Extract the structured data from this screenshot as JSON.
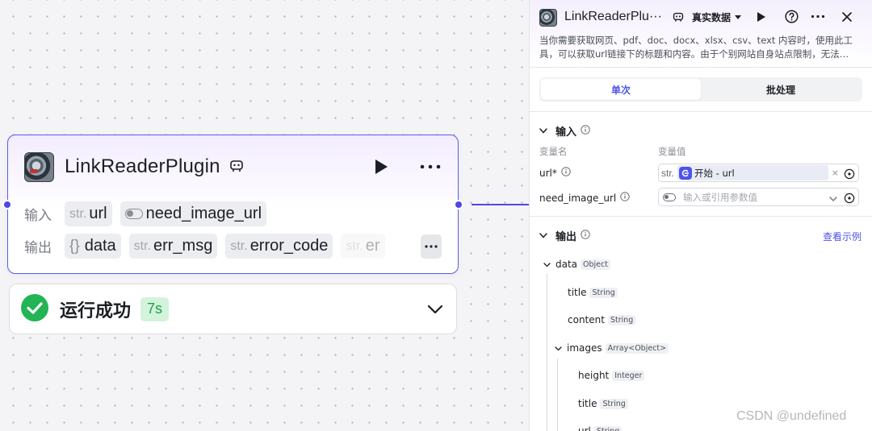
{
  "node": {
    "title": "LinkReaderPlugin",
    "input_label": "输入",
    "output_label": "输出",
    "inputs": [
      {
        "type": "str.",
        "name": "url"
      },
      {
        "name": "need_image_url"
      }
    ],
    "outputs": [
      {
        "type": "{}",
        "name": "data"
      },
      {
        "type": "str.",
        "name": "err_msg"
      },
      {
        "type": "str.",
        "name": "error_code"
      },
      {
        "type": "str.",
        "name": "er"
      }
    ]
  },
  "status": {
    "text": "运行成功",
    "time": "7s"
  },
  "panel": {
    "title": "LinkReaderPlu···",
    "data_mode": "真实数据",
    "description": "当你需要获取网页、pdf、doc、docx、xlsx、csv、text 内容时，使用此工具，可以获取url链接下的标题和内容。由于个别网站自身站点限制，无法…",
    "tabs": [
      "单次",
      "批处理"
    ],
    "input_section": "输入",
    "col_name": "变量名",
    "col_value": "变量值",
    "fields": [
      {
        "label": "url*",
        "type": "str.",
        "ref_text": "开始 - url",
        "clear": "×"
      },
      {
        "label": "need_image_url",
        "placeholder": "输入或引用参数值"
      }
    ],
    "output_section": "输出",
    "view_example": "查看示例",
    "tree": [
      {
        "name": "data",
        "type": "Object"
      },
      {
        "name": "title",
        "type": "String"
      },
      {
        "name": "content",
        "type": "String"
      },
      {
        "name": "images",
        "type": "Array<Object>"
      },
      {
        "name": "height",
        "type": "Integer"
      },
      {
        "name": "title",
        "type": "String"
      },
      {
        "name": "url",
        "type": "String"
      }
    ]
  },
  "watermark": "CSDN @undefined",
  "colors": {
    "accent": "#4d53e8",
    "node_border": "#5b5ee8",
    "success": "#1f9e47",
    "success_bg": "#d3f3dc"
  }
}
